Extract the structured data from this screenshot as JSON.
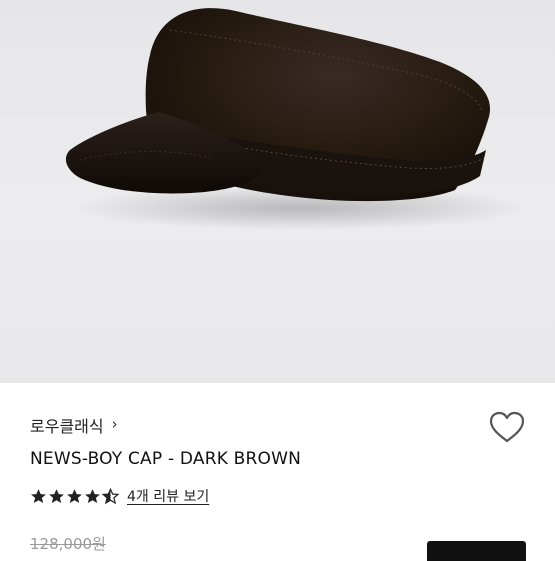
{
  "product": {
    "image_alt": "news-boy cap product photo",
    "brand": "로우클래식",
    "name": "NEWS-BOY CAP - DARK BROWN",
    "rating": 4.5,
    "rating_max": 5,
    "reviews_link": "4개 리뷰 보기",
    "original_price": "128,000원"
  },
  "icons": {
    "brand_chevron": "chevron-right-icon",
    "wishlist": "heart-outline-icon",
    "star": "star-icon"
  },
  "colors": {
    "hero_bg": "#e8e8ea",
    "cap": "#2b1f1a",
    "text": "#111111",
    "muted": "#9a9a9a",
    "button": "#111111"
  }
}
